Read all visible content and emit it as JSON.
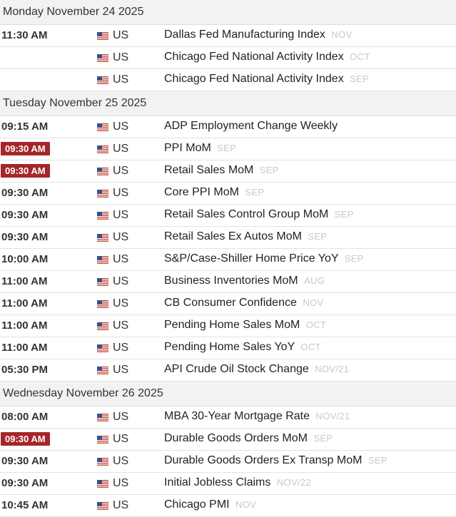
{
  "days": [
    {
      "date": "Monday November 24 2025",
      "events": [
        {
          "time": "11:30 AM",
          "highlight": false,
          "country": "US",
          "name": "Dallas Fed Manufacturing Index",
          "period": "NOV"
        },
        {
          "time": "",
          "highlight": false,
          "country": "US",
          "name": "Chicago Fed National Activity Index",
          "period": "OCT"
        },
        {
          "time": "",
          "highlight": false,
          "country": "US",
          "name": "Chicago Fed National Activity Index",
          "period": "SEP"
        }
      ]
    },
    {
      "date": "Tuesday November 25 2025",
      "events": [
        {
          "time": "09:15 AM",
          "highlight": false,
          "country": "US",
          "name": "ADP Employment Change Weekly",
          "period": ""
        },
        {
          "time": "09:30 AM",
          "highlight": true,
          "country": "US",
          "name": "PPI MoM",
          "period": "SEP"
        },
        {
          "time": "09:30 AM",
          "highlight": true,
          "country": "US",
          "name": "Retail Sales MoM",
          "period": "SEP"
        },
        {
          "time": "09:30 AM",
          "highlight": false,
          "country": "US",
          "name": "Core PPI MoM",
          "period": "SEP"
        },
        {
          "time": "09:30 AM",
          "highlight": false,
          "country": "US",
          "name": "Retail Sales Control Group MoM",
          "period": "SEP"
        },
        {
          "time": "09:30 AM",
          "highlight": false,
          "country": "US",
          "name": "Retail Sales Ex Autos MoM",
          "period": "SEP"
        },
        {
          "time": "10:00 AM",
          "highlight": false,
          "country": "US",
          "name": "S&P/Case-Shiller Home Price YoY",
          "period": "SEP"
        },
        {
          "time": "11:00 AM",
          "highlight": false,
          "country": "US",
          "name": "Business Inventories MoM",
          "period": "AUG"
        },
        {
          "time": "11:00 AM",
          "highlight": false,
          "country": "US",
          "name": "CB Consumer Confidence",
          "period": "NOV"
        },
        {
          "time": "11:00 AM",
          "highlight": false,
          "country": "US",
          "name": "Pending Home Sales MoM",
          "period": "OCT"
        },
        {
          "time": "11:00 AM",
          "highlight": false,
          "country": "US",
          "name": "Pending Home Sales YoY",
          "period": "OCT"
        },
        {
          "time": "05:30 PM",
          "highlight": false,
          "country": "US",
          "name": "API Crude Oil Stock Change",
          "period": "NOV/21"
        }
      ]
    },
    {
      "date": "Wednesday November 26 2025",
      "events": [
        {
          "time": "08:00 AM",
          "highlight": false,
          "country": "US",
          "name": "MBA 30-Year Mortgage Rate",
          "period": "NOV/21"
        },
        {
          "time": "09:30 AM",
          "highlight": true,
          "country": "US",
          "name": "Durable Goods Orders MoM",
          "period": "SEP"
        },
        {
          "time": "09:30 AM",
          "highlight": false,
          "country": "US",
          "name": "Durable Goods Orders Ex Transp MoM",
          "period": "SEP"
        },
        {
          "time": "09:30 AM",
          "highlight": false,
          "country": "US",
          "name": "Initial Jobless Claims",
          "period": "NOV/22"
        },
        {
          "time": "10:45 AM",
          "highlight": false,
          "country": "US",
          "name": "Chicago PMI",
          "period": "NOV"
        }
      ]
    }
  ],
  "colors": {
    "highlight_bg": "#a5262b",
    "period_text": "#c8c8c8",
    "header_bg": "#f2f2f2"
  },
  "icons": {
    "flag": "us-flag-icon"
  }
}
